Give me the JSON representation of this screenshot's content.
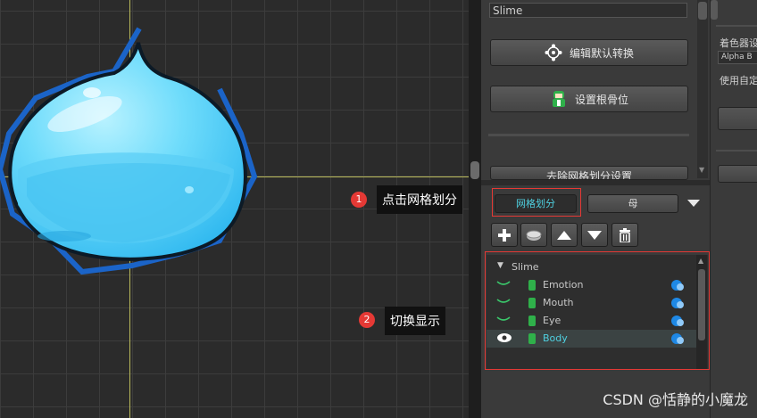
{
  "inspector": {
    "name_field": "Slime",
    "edit_default_transform_btn": "编辑默认转换",
    "set_root_bone_btn": "设置根骨位",
    "partial_btn_text": "去除网格划分设置"
  },
  "mesh_panel": {
    "tabs": [
      {
        "label": "网格划分",
        "active": true
      },
      {
        "label": "母",
        "active": false
      }
    ],
    "toolbar_icons": [
      "plus-icon",
      "disc-icon",
      "arrow-up-icon",
      "arrow-down-icon",
      "trash-icon"
    ]
  },
  "tree": {
    "root": "Slime",
    "items": [
      {
        "label": "Emotion",
        "visible": false,
        "selected": false
      },
      {
        "label": "Mouth",
        "visible": false,
        "selected": false
      },
      {
        "label": "Eye",
        "visible": false,
        "selected": false
      },
      {
        "label": "Body",
        "visible": true,
        "selected": true
      }
    ]
  },
  "callouts": [
    {
      "number": "1",
      "text": "点击网格划分"
    },
    {
      "number": "2",
      "text": "切换显示"
    }
  ],
  "right_panel": {
    "shader_label": "着色器设",
    "blend_field": "Alpha B",
    "custom_label": "使用自定"
  },
  "watermark": "CSDN @恬静的小魔龙",
  "colors": {
    "callout_red": "#e53935",
    "active_tab_text": "#4fd0e0",
    "slime_blue": "#46c8f0",
    "mesh_outline": "#1b64c8"
  }
}
